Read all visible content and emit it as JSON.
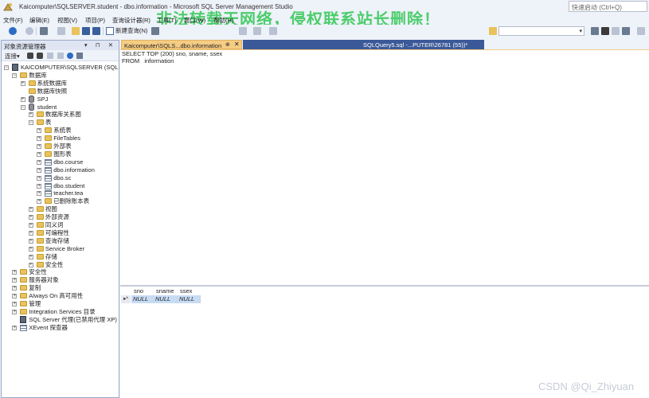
{
  "window": {
    "title": "Kaicomputer\\SQLSERVER.student - dbo.information - Microsoft SQL Server Management Studio",
    "quick_launch_placeholder": "快速启动 (Ctrl+Q)",
    "watermark": "非法转载天网络，侵权联系站长删除！"
  },
  "menu": {
    "items": [
      {
        "label": "文件(F)"
      },
      {
        "label": "编辑(E)"
      },
      {
        "label": "视图(V)"
      },
      {
        "label": "项目(P)"
      },
      {
        "label": "查询设计器(R)"
      },
      {
        "label": "工具(T)"
      },
      {
        "label": "窗口(W)"
      },
      {
        "label": "帮助(H)"
      }
    ]
  },
  "toolbar": {
    "new_query_label": "新建查询(N)"
  },
  "object_explorer": {
    "title": "对象资源管理器",
    "header_icons": "▾ ⊓ ✕",
    "connect_label": "连接▾",
    "tree": [
      {
        "label": "KAICOMPUTER\\SQLSERVER (SQL Ser",
        "expander": "−",
        "icon": "server"
      },
      {
        "label": "数据库",
        "expander": "−",
        "icon": "folder"
      },
      {
        "label": "系统数据库",
        "expander": "+",
        "icon": "folder"
      },
      {
        "label": "数据库快照",
        "expander": "",
        "icon": "folder"
      },
      {
        "label": "SPJ",
        "expander": "+",
        "icon": "database"
      },
      {
        "label": "student",
        "expander": "−",
        "icon": "database"
      },
      {
        "label": "数据库关系图",
        "expander": "+",
        "icon": "folder"
      },
      {
        "label": "表",
        "expander": "−",
        "icon": "folder"
      },
      {
        "label": "系统表",
        "expander": "+",
        "icon": "folder"
      },
      {
        "label": "FileTables",
        "expander": "+",
        "icon": "folder"
      },
      {
        "label": "外部表",
        "expander": "+",
        "icon": "folder"
      },
      {
        "label": "图形表",
        "expander": "+",
        "icon": "folder"
      },
      {
        "label": "dbo.course",
        "expander": "+",
        "icon": "table"
      },
      {
        "label": "dbo.information",
        "expander": "+",
        "icon": "table"
      },
      {
        "label": "dbo.sc",
        "expander": "+",
        "icon": "table"
      },
      {
        "label": "dbo.student",
        "expander": "+",
        "icon": "table"
      },
      {
        "label": "teacher.tea",
        "expander": "+",
        "icon": "table"
      },
      {
        "label": "已删除账本表",
        "expander": "+",
        "icon": "folder"
      },
      {
        "label": "视图",
        "expander": "+",
        "icon": "folder"
      },
      {
        "label": "外部资源",
        "expander": "+",
        "icon": "folder"
      },
      {
        "label": "同义词",
        "expander": "+",
        "icon": "folder"
      },
      {
        "label": "可编程性",
        "expander": "+",
        "icon": "folder"
      },
      {
        "label": "查询存储",
        "expander": "+",
        "icon": "folder"
      },
      {
        "label": "Service Broker",
        "expander": "+",
        "icon": "folder"
      },
      {
        "label": "存储",
        "expander": "+",
        "icon": "folder"
      },
      {
        "label": "安全性",
        "expander": "+",
        "icon": "folder"
      },
      {
        "label": "安全性",
        "expander": "+",
        "icon": "folder"
      },
      {
        "label": "服务器对象",
        "expander": "+",
        "icon": "folder"
      },
      {
        "label": "复制",
        "expander": "+",
        "icon": "folder"
      },
      {
        "label": "Always On 高可用性",
        "expander": "+",
        "icon": "folder"
      },
      {
        "label": "管理",
        "expander": "+",
        "icon": "folder"
      },
      {
        "label": "Integration Services 目录",
        "expander": "+",
        "icon": "folder"
      },
      {
        "label": "SQL Server 代理(已禁用代理 XP)",
        "expander": "",
        "icon": "agent"
      },
      {
        "label": "XEvent 探查器",
        "expander": "+",
        "icon": "xevent"
      }
    ]
  },
  "tabs": {
    "active": {
      "label": "Kaicomputer\\SQLS...dbo.information",
      "pin": "⊕",
      "close": "✕"
    },
    "inactive": {
      "label": "SQLQuery5.sql -...PUTER\\26781 (55))*"
    }
  },
  "editor": {
    "lines": [
      "SELECT TOP (200) sno, sname, ssex",
      "FROM   information"
    ]
  },
  "results": {
    "columns": [
      "sno",
      "sname",
      "ssex"
    ],
    "row_indicator": "▸*",
    "rows": [
      [
        "NULL",
        "NULL",
        "NULL"
      ]
    ]
  },
  "footer": {
    "credit": "CSDN @Qi_Zhiyuan"
  }
}
